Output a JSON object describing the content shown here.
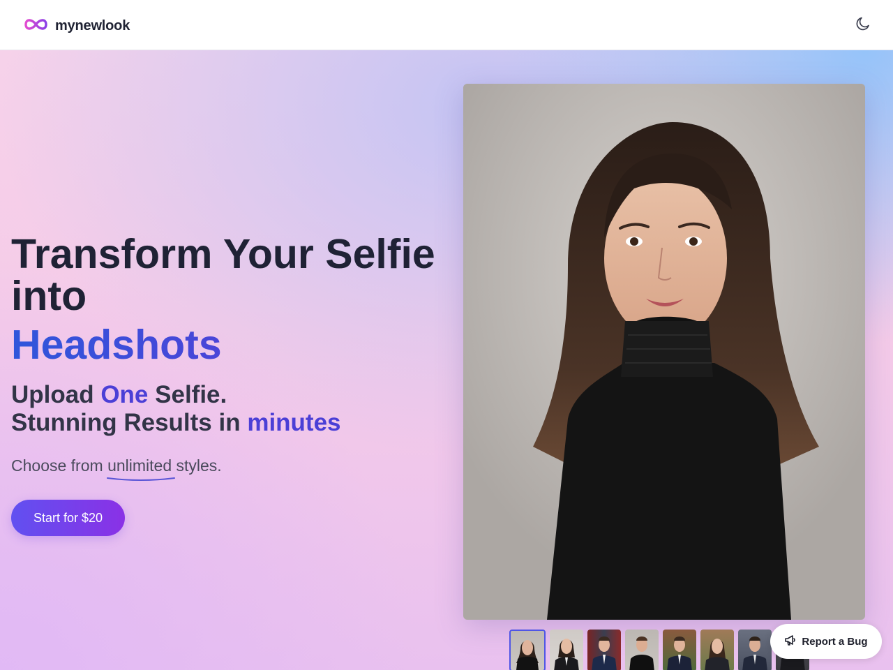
{
  "header": {
    "brand": "mynewlook",
    "logo_icon": "infinity-icon",
    "theme_toggle_icon": "moon-icon"
  },
  "hero": {
    "headline": "Transform Your Selfie into",
    "headline_accent": "Headshots",
    "sub_line1": {
      "a": "Upload ",
      "b": "One",
      "c": " Selfie."
    },
    "sub_line2": {
      "a": "Stunning Results in ",
      "b": "minutes"
    },
    "tagline": {
      "a": "Choose from ",
      "b": "unlimited",
      "c": " styles."
    },
    "cta_label": "Start for $20"
  },
  "gallery": {
    "selected_index": 0,
    "thumbnails": [
      "woman-black-turtleneck",
      "woman-suit",
      "man-navy-suit-city",
      "man-black-turtleneck",
      "man-suit-outdoor",
      "woman-suit-outdoor",
      "man-suit-city",
      "man-dark-suit"
    ]
  },
  "report_bug": {
    "label": "Report a Bug",
    "icon": "megaphone-icon"
  },
  "colors": {
    "accent_blue": "#2f56db",
    "accent_purple": "#4b3fd6",
    "cta_start": "#6150f0",
    "cta_end": "#8a31e6",
    "heading": "#1f2235"
  }
}
